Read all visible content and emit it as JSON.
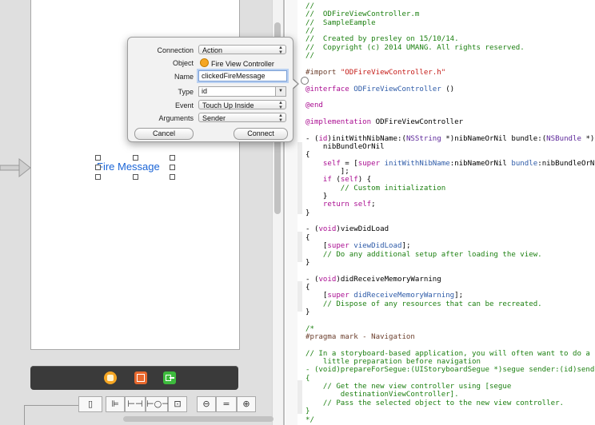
{
  "canvas": {
    "label_text": "Fire Message"
  },
  "popover": {
    "connection": {
      "label": "Connection",
      "value": "Action"
    },
    "object": {
      "label": "Object",
      "value": "Fire View Controller"
    },
    "name": {
      "label": "Name",
      "value": "clickedFireMessage"
    },
    "type": {
      "label": "Type",
      "value": "id"
    },
    "event": {
      "label": "Event",
      "value": "Touch Up Inside"
    },
    "arguments": {
      "label": "Arguments",
      "value": "Sender"
    },
    "cancel_label": "Cancel",
    "connect_label": "Connect"
  },
  "dock": {
    "icons": [
      "first-responder-icon",
      "view-controller-icon",
      "exit-icon"
    ],
    "colors": {
      "first_responder": "#f5a623",
      "view_controller": "#e8692e",
      "exit": "#3dbb3d"
    }
  },
  "layout_bar": {
    "icons": [
      "simulated-metrics-icon",
      "align-icon",
      "pin-icon",
      "resolve-autolayout-icon",
      "resizing-icon",
      "zoom-out-icon",
      "zoom-actual-icon",
      "zoom-in-icon"
    ]
  },
  "code": {
    "lines": [
      {
        "segments": [
          {
            "t": "//",
            "c": "c-comment"
          }
        ]
      },
      {
        "segments": [
          {
            "t": "//  ODFireViewController.m",
            "c": "c-comment"
          }
        ]
      },
      {
        "segments": [
          {
            "t": "//  SampleEample",
            "c": "c-comment"
          }
        ]
      },
      {
        "segments": [
          {
            "t": "//",
            "c": "c-comment"
          }
        ]
      },
      {
        "segments": [
          {
            "t": "//  Created by presley on 15/10/14.",
            "c": "c-comment"
          }
        ]
      },
      {
        "segments": [
          {
            "t": "//  Copyright (c) 2014 UMANG. All rights reserved.",
            "c": "c-comment"
          }
        ]
      },
      {
        "segments": [
          {
            "t": "//",
            "c": "c-comment"
          }
        ]
      },
      {
        "segments": []
      },
      {
        "segments": [
          {
            "t": "#import ",
            "c": "c-directive"
          },
          {
            "t": "\"ODFireViewController.h\"",
            "c": "c-string"
          }
        ]
      },
      {
        "segments": []
      },
      {
        "segments": [
          {
            "t": "@interface",
            "c": "c-keyword"
          },
          {
            "t": " ",
            "c": "c-plain"
          },
          {
            "t": "ODFireViewController",
            "c": "c-method"
          },
          {
            "t": " ()",
            "c": "c-plain"
          }
        ]
      },
      {
        "segments": []
      },
      {
        "segments": [
          {
            "t": "@end",
            "c": "c-keyword"
          }
        ]
      },
      {
        "segments": []
      },
      {
        "segments": [
          {
            "t": "@implementation",
            "c": "c-keyword"
          },
          {
            "t": " ODFireViewController",
            "c": "c-plain"
          }
        ]
      },
      {
        "segments": []
      },
      {
        "segments": [
          {
            "t": "- (",
            "c": "c-plain"
          },
          {
            "t": "id",
            "c": "c-keyword"
          },
          {
            "t": ")initWithNibName:(",
            "c": "c-plain"
          },
          {
            "t": "NSString",
            "c": "c-type"
          },
          {
            "t": " *)nibNameOrNil bundle:(",
            "c": "c-plain"
          },
          {
            "t": "NSBundle",
            "c": "c-type"
          },
          {
            "t": " *)",
            "c": "c-plain"
          }
        ]
      },
      {
        "segments": [
          {
            "t": "    nibBundleOrNil",
            "c": "c-plain"
          }
        ]
      },
      {
        "segments": [
          {
            "t": "{",
            "c": "c-plain"
          }
        ]
      },
      {
        "segments": [
          {
            "t": "    ",
            "c": "c-plain"
          },
          {
            "t": "self",
            "c": "c-keyword"
          },
          {
            "t": " = [",
            "c": "c-plain"
          },
          {
            "t": "super",
            "c": "c-keyword"
          },
          {
            "t": " ",
            "c": "c-plain"
          },
          {
            "t": "initWithNibName",
            "c": "c-method"
          },
          {
            "t": ":nibNameOrNil ",
            "c": "c-plain"
          },
          {
            "t": "bundle",
            "c": "c-method"
          },
          {
            "t": ":nibBundleOrNil",
            "c": "c-plain"
          }
        ]
      },
      {
        "segments": [
          {
            "t": "        ];",
            "c": "c-plain"
          }
        ]
      },
      {
        "segments": [
          {
            "t": "    ",
            "c": "c-plain"
          },
          {
            "t": "if",
            "c": "c-keyword"
          },
          {
            "t": " (",
            "c": "c-plain"
          },
          {
            "t": "self",
            "c": "c-keyword"
          },
          {
            "t": ") {",
            "c": "c-plain"
          }
        ]
      },
      {
        "segments": [
          {
            "t": "        // Custom initialization",
            "c": "c-comment"
          }
        ]
      },
      {
        "segments": [
          {
            "t": "    }",
            "c": "c-plain"
          }
        ]
      },
      {
        "segments": [
          {
            "t": "    ",
            "c": "c-plain"
          },
          {
            "t": "return",
            "c": "c-keyword"
          },
          {
            "t": " ",
            "c": "c-plain"
          },
          {
            "t": "self",
            "c": "c-keyword"
          },
          {
            "t": ";",
            "c": "c-plain"
          }
        ]
      },
      {
        "segments": [
          {
            "t": "}",
            "c": "c-plain"
          }
        ]
      },
      {
        "segments": []
      },
      {
        "segments": [
          {
            "t": "- (",
            "c": "c-plain"
          },
          {
            "t": "void",
            "c": "c-keyword"
          },
          {
            "t": ")viewDidLoad",
            "c": "c-plain"
          }
        ]
      },
      {
        "segments": [
          {
            "t": "{",
            "c": "c-plain"
          }
        ]
      },
      {
        "segments": [
          {
            "t": "    [",
            "c": "c-plain"
          },
          {
            "t": "super",
            "c": "c-keyword"
          },
          {
            "t": " ",
            "c": "c-plain"
          },
          {
            "t": "viewDidLoad",
            "c": "c-method"
          },
          {
            "t": "];",
            "c": "c-plain"
          }
        ]
      },
      {
        "segments": [
          {
            "t": "    // Do any additional setup after loading the view.",
            "c": "c-comment"
          }
        ]
      },
      {
        "segments": [
          {
            "t": "}",
            "c": "c-plain"
          }
        ]
      },
      {
        "segments": []
      },
      {
        "segments": [
          {
            "t": "- (",
            "c": "c-plain"
          },
          {
            "t": "void",
            "c": "c-keyword"
          },
          {
            "t": ")didReceiveMemoryWarning",
            "c": "c-plain"
          }
        ]
      },
      {
        "segments": [
          {
            "t": "{",
            "c": "c-plain"
          }
        ]
      },
      {
        "segments": [
          {
            "t": "    [",
            "c": "c-plain"
          },
          {
            "t": "super",
            "c": "c-keyword"
          },
          {
            "t": " ",
            "c": "c-plain"
          },
          {
            "t": "didReceiveMemoryWarning",
            "c": "c-method"
          },
          {
            "t": "];",
            "c": "c-plain"
          }
        ]
      },
      {
        "segments": [
          {
            "t": "    // Dispose of any resources that can be recreated.",
            "c": "c-comment"
          }
        ]
      },
      {
        "segments": [
          {
            "t": "}",
            "c": "c-plain"
          }
        ]
      },
      {
        "segments": []
      },
      {
        "segments": [
          {
            "t": "/*",
            "c": "c-comment"
          }
        ]
      },
      {
        "segments": [
          {
            "t": "#pragma mark - Navigation",
            "c": "c-directive"
          }
        ]
      },
      {
        "segments": []
      },
      {
        "segments": [
          {
            "t": "// In a storyboard-based application, you will often want to do a",
            "c": "c-comment"
          }
        ]
      },
      {
        "segments": [
          {
            "t": "    little preparation before navigation",
            "c": "c-comment"
          }
        ]
      },
      {
        "segments": [
          {
            "t": "- (void)prepareForSegue:(UIStoryboardSegue *)segue sender:(id)sender",
            "c": "c-comment"
          }
        ]
      },
      {
        "segments": [
          {
            "t": "{",
            "c": "c-comment"
          }
        ]
      },
      {
        "segments": [
          {
            "t": "    // Get the new view controller using [segue",
            "c": "c-comment"
          }
        ]
      },
      {
        "segments": [
          {
            "t": "        destinationViewController].",
            "c": "c-comment"
          }
        ]
      },
      {
        "segments": [
          {
            "t": "    // Pass the selected object to the new view controller.",
            "c": "c-comment"
          }
        ]
      },
      {
        "segments": [
          {
            "t": "}",
            "c": "c-comment"
          }
        ]
      },
      {
        "segments": [
          {
            "t": "*/",
            "c": "c-comment"
          }
        ]
      }
    ]
  }
}
